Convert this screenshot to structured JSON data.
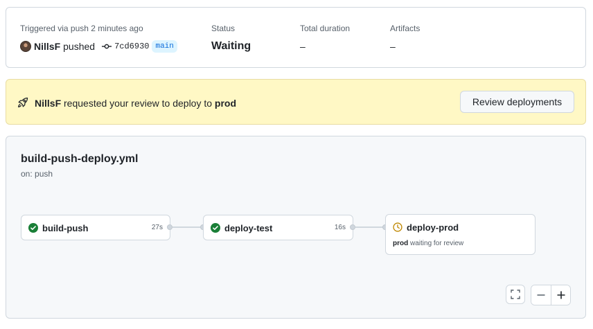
{
  "summary": {
    "trigger_label": "Triggered via push 2 minutes ago",
    "actor": "NillsF",
    "action": "pushed",
    "commit_sha": "7cd6930",
    "branch": "main",
    "status_label": "Status",
    "status_value": "Waiting",
    "duration_label": "Total duration",
    "duration_value": "–",
    "artifacts_label": "Artifacts",
    "artifacts_value": "–"
  },
  "banner": {
    "actor": "NillsF",
    "text_mid": "requested your review to deploy to",
    "environment": "prod",
    "button_label": "Review deployments"
  },
  "workflow": {
    "file": "build-push-deploy.yml",
    "trigger": "on: push",
    "jobs": [
      {
        "name": "build-push",
        "duration": "27s",
        "status": "success"
      },
      {
        "name": "deploy-test",
        "duration": "16s",
        "status": "success"
      },
      {
        "name": "deploy-prod",
        "status": "waiting",
        "note_env": "prod",
        "note_text": "waiting for review"
      }
    ]
  },
  "colors": {
    "success": "#1a7f37",
    "waiting": "#bf8700",
    "accent": "#0969da",
    "banner_bg": "#fff8c5"
  },
  "icons": {
    "commit": "git-commit-icon",
    "rocket": "rocket-icon",
    "check": "check-circle-icon",
    "clock": "clock-icon",
    "fullscreen": "fullscreen-icon",
    "zoom_out": "zoom-out-icon",
    "zoom_in": "zoom-in-icon"
  }
}
